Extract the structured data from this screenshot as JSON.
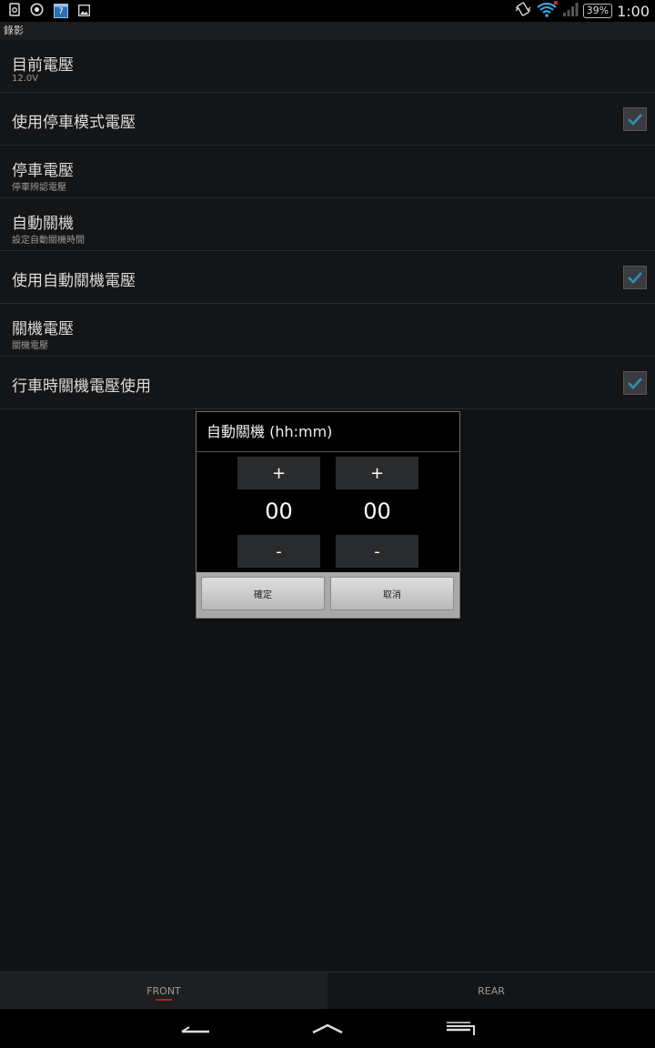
{
  "status_bar": {
    "icons": [
      "screenshot-icon",
      "camera-icon",
      "calendar-icon",
      "gallery-icon"
    ],
    "calendar_day": "7",
    "right_icons": [
      "vibrate-icon",
      "wifi-icon",
      "signal-icon"
    ],
    "battery": "39%",
    "time": "1:00"
  },
  "app": {
    "title": "錄影"
  },
  "settings": [
    {
      "title": "目前電壓",
      "summary": "12.0V",
      "checkbox": false
    },
    {
      "title": "使用停車模式電壓",
      "summary": "",
      "checkbox": true,
      "checked": true
    },
    {
      "title": "停車電壓",
      "summary": "停車辨認電壓",
      "checkbox": false
    },
    {
      "title": "自動關機",
      "summary": "設定自動關機時間",
      "checkbox": false
    },
    {
      "title": "使用自動關機電壓",
      "summary": "",
      "checkbox": true,
      "checked": true
    },
    {
      "title": "關機電壓",
      "summary": "關機電壓",
      "checkbox": false
    },
    {
      "title": "行車時關機電壓使用",
      "summary": "",
      "checkbox": true,
      "checked": true
    }
  ],
  "dialog": {
    "title": "自動關機 (hh:mm)",
    "hours": {
      "plus": "+",
      "value": "00",
      "minus": "-"
    },
    "minutes": {
      "plus": "+",
      "value": "00",
      "minus": "-"
    },
    "ok_label": "確定",
    "cancel_label": "取消"
  },
  "tabs": [
    {
      "label": "FRONT",
      "active": true
    },
    {
      "label": "REAR",
      "active": false
    }
  ],
  "colors": {
    "checkmark": "#2f8fb3",
    "tab_indicator": "#b32020"
  }
}
